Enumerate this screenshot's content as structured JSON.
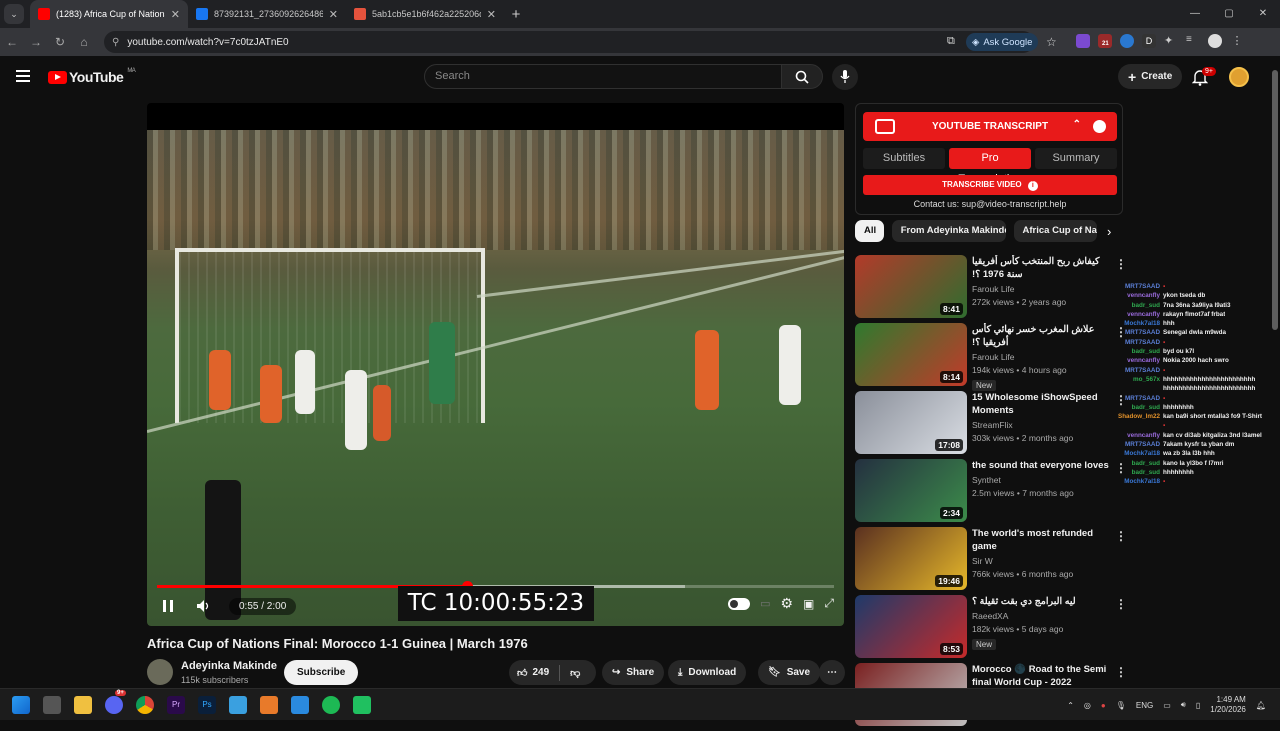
{
  "browser": {
    "tabs": [
      {
        "title": "(1283) Africa Cup of Nations",
        "active": true,
        "favicon_color": "#ff0000"
      },
      {
        "title": "87392131_2736092626486694_",
        "active": false,
        "favicon_color": "#1877f2"
      },
      {
        "title": "5ab1cb5e1b6f462a225206dc2e",
        "active": false,
        "favicon_color": "#e5533d"
      }
    ],
    "url": "youtube.com/watch?v=7c0tzJATnE0",
    "ask_google": "Ask Google",
    "ext_badge": "21"
  },
  "youtube": {
    "logo_text": "YouTube",
    "region": "MA",
    "search_placeholder": "Search",
    "create_label": "Create",
    "notif_badge": "9+"
  },
  "video": {
    "title": "Africa Cup of Nations Final: Morocco 1-1 Guinea | March 1976",
    "time": "0:55 / 2:00",
    "progress_fraction": 0.458,
    "buffered_fraction": 0.78,
    "timecode": "TC 10:00:55:23",
    "channel": "Adeyinka Makinde",
    "subscribers": "115k subscribers",
    "subscribe_label": "Subscribe",
    "likes": "249",
    "share_label": "Share",
    "download_label": "Download",
    "save_label": "Save"
  },
  "extension": {
    "title": "YOUTUBE TRANSCRIPT",
    "tabs": [
      "Subtitles",
      "Pro Transcription",
      "Summary"
    ],
    "active_tab": "Pro Transcription",
    "button": "TRANSCRIBE VIDEO",
    "contact": "Contact us: sup@video-transcript.help",
    "accent": "#e81a1a"
  },
  "chips": [
    "All",
    "From Adeyinka Makinde",
    "Africa Cup of Na"
  ],
  "recommendations": [
    {
      "title": "كيفاش ربح المنتخب كأس أفريقيا سنة 1976 ؟!",
      "channel": "Farouk Life",
      "meta": "272k views • 2 years ago",
      "duration": "8:41",
      "badge": "",
      "thumb_colors": [
        "#b33a2a",
        "#2f6d2f"
      ]
    },
    {
      "title": "علاش المغرب خسر نهائي كأس أفريقيا ؟!",
      "channel": "Farouk Life",
      "meta": "194k views • 4 hours ago",
      "duration": "8:14",
      "badge": "New",
      "thumb_colors": [
        "#2e7a2e",
        "#c23a2a"
      ]
    },
    {
      "title": "15 Wholesome iShowSpeed Moments",
      "channel": "StreamFlix",
      "meta": "303k views • 2 months ago",
      "duration": "17:08",
      "badge": "",
      "thumb_colors": [
        "#8a8f9a",
        "#d9dde3"
      ]
    },
    {
      "title": "the sound that everyone loves",
      "channel": "Synthet",
      "meta": "2.5m views • 7 months ago",
      "duration": "2:34",
      "badge": "",
      "thumb_colors": [
        "#243040",
        "#3c8c4a"
      ]
    },
    {
      "title": "The world's most refunded game",
      "channel": "Sir W",
      "meta": "766k views • 6 months ago",
      "duration": "19:46",
      "badge": "",
      "thumb_colors": [
        "#5a3020",
        "#e6b82a"
      ]
    },
    {
      "title": "ليه البرامج دي بقت ثقيلة ؟",
      "channel": "RaeedXA",
      "meta": "182k views • 5 days ago",
      "duration": "8:53",
      "badge": "New",
      "thumb_colors": [
        "#1e3a6a",
        "#c62a2a"
      ]
    },
    {
      "title": "Morocco 🌑 Road to the Semi final World Cup - 2022",
      "channel": "",
      "meta": "",
      "duration": "",
      "badge": "",
      "thumb_colors": [
        "#7a2020",
        "#c0c0c0"
      ]
    }
  ],
  "chat": [
    {
      "user": "MRT7SAAD",
      "msg": "",
      "color": "#5b7fd6"
    },
    {
      "user": "venncanfly",
      "msg": "ykon tseda db",
      "color": "#9a6bdc"
    },
    {
      "user": "badr_sud",
      "msg": "7na 36na 3a9liya l9ati3",
      "color": "#2fa84f"
    },
    {
      "user": "venncanfly",
      "msg": "rakayn flmot7af frbat",
      "color": "#9a6bdc"
    },
    {
      "user": "Mochk7al18",
      "msg": "hhh",
      "color": "#3a78d6"
    },
    {
      "user": "MRT7SAAD",
      "msg": "Senegal dwla m9wda",
      "color": "#5b7fd6"
    },
    {
      "user": "MRT7SAAD",
      "msg": "",
      "color": "#5b7fd6"
    },
    {
      "user": "badr_sud",
      "msg": "byd ou k7l",
      "color": "#2fa84f"
    },
    {
      "user": "venncanfly",
      "msg": "Nokia 2000 hach swro",
      "color": "#9a6bdc"
    },
    {
      "user": "MRT7SAAD",
      "msg": "",
      "color": "#5b7fd6"
    },
    {
      "user": "mo_567x",
      "msg": "hhhhhhhhhhhhhhhhhhhhhhhh",
      "color": "#2fa84f"
    },
    {
      "user": "",
      "msg": "hhhhhhhhhhhhhhhhhhhhhhhh",
      "color": "#2fa84f"
    },
    {
      "user": "MRT7SAAD",
      "msg": "",
      "color": "#5b7fd6"
    },
    {
      "user": "badr_sud",
      "msg": "hhhhhhhh",
      "color": "#2fa84f"
    },
    {
      "user": "Shadow_lm22",
      "msg": "kan ba9i short mtalla3 fo9 T-Shirt",
      "color": "#e0902a"
    },
    {
      "user": "",
      "msg": "",
      "color": "#e0902a"
    },
    {
      "user": "venncanfly",
      "msg": "kan cv di3ab kitgaliza 3nd l3amel",
      "color": "#9a6bdc"
    },
    {
      "user": "MRT7SAAD",
      "msg": "7akam kysfr ta yban dm",
      "color": "#5b7fd6"
    },
    {
      "user": "Mochk7al18",
      "msg": "wa zb 3la l3b hhh",
      "color": "#3a78d6"
    },
    {
      "user": "badr_sud",
      "msg": "kano la yl3bo f l7mri",
      "color": "#2fa84f"
    },
    {
      "user": "badr_sud",
      "msg": "hhhhhhhh",
      "color": "#2fa84f"
    },
    {
      "user": "Mochk7al18",
      "msg": "",
      "color": "#3a78d6"
    }
  ],
  "taskbar": {
    "lang": "ENG",
    "time": "1:49 AM",
    "date": "1/20/2026",
    "discord_badge": "9+"
  }
}
